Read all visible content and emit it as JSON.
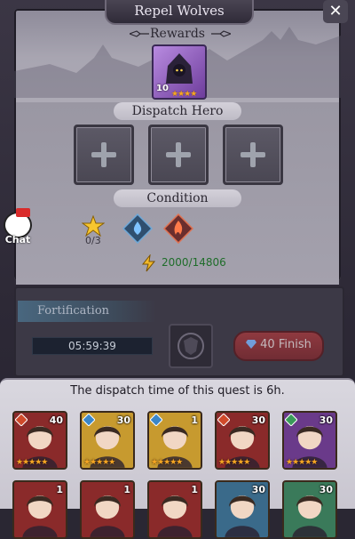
{
  "title": "Repel Wolves",
  "close_icon": "close-icon",
  "rewards": {
    "label": "Rewards",
    "item": {
      "icon": "hooded-figure-icon",
      "quantity": "10",
      "stars": "★★★★"
    }
  },
  "dispatch": {
    "label": "Dispatch Hero",
    "slots": [
      {
        "icon": "plus-icon"
      },
      {
        "icon": "plus-icon"
      },
      {
        "icon": "plus-icon"
      }
    ]
  },
  "condition": {
    "label": "Condition",
    "star_count": "0/3",
    "elements": [
      "water-element-icon",
      "fire-element-icon"
    ],
    "power": "2000/14806"
  },
  "chat": {
    "label": "Chat"
  },
  "fortification": {
    "tab_label": "Fortification",
    "timer": "05:59:39",
    "finish_label": "40 Finish"
  },
  "dispatch_time": "The dispatch time of this quest is 6h.",
  "heroes_row1": [
    {
      "level": "40",
      "stars": "★★★★★",
      "frame": "#8a2a2a",
      "elem": "#d04a2a"
    },
    {
      "level": "30",
      "stars": "★★★★★",
      "frame": "#c79a2f",
      "elem": "#3a86c8"
    },
    {
      "level": "1",
      "stars": "★★★★★",
      "frame": "#c79a2f",
      "elem": "#3a86c8"
    },
    {
      "level": "30",
      "stars": "★★★★★",
      "frame": "#8a2a2a",
      "elem": "#d04a2a"
    },
    {
      "level": "30",
      "stars": "★★★★★",
      "frame": "#6a3a8a",
      "elem": "#3a9a5a"
    }
  ],
  "heroes_row2": [
    {
      "level": "1",
      "frame": "#8a2a2a"
    },
    {
      "level": "1",
      "frame": "#8a2a2a"
    },
    {
      "level": "1",
      "frame": "#8a2a2a"
    },
    {
      "level": "30",
      "frame": "#3a6a8a"
    },
    {
      "level": "30",
      "frame": "#3a7a5a"
    }
  ]
}
